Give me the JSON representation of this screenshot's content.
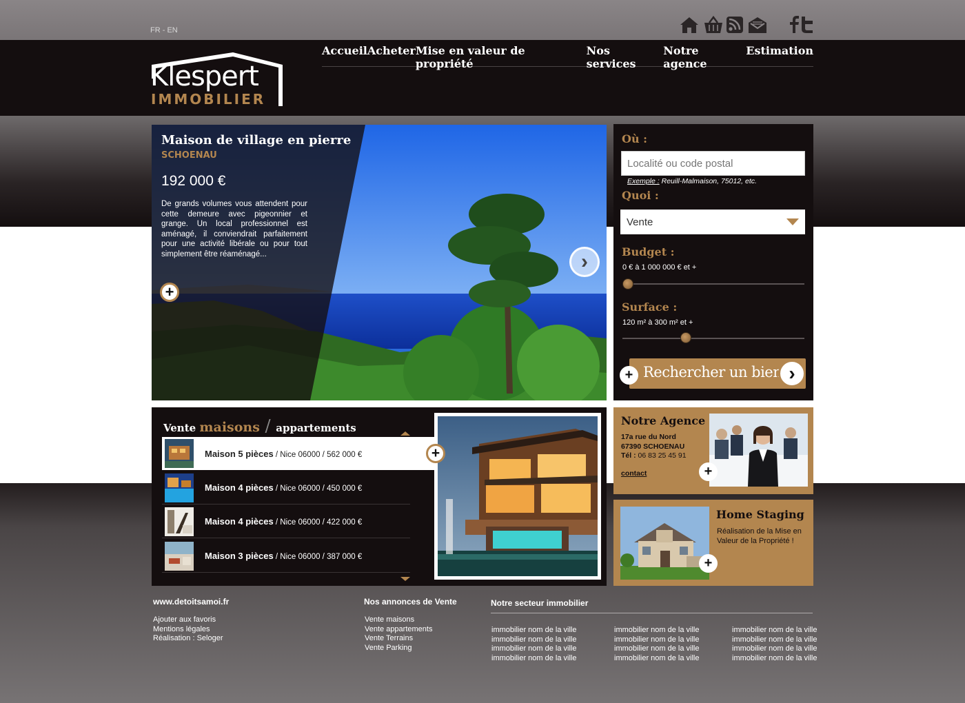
{
  "lang_switch": "FR - EN",
  "icons": [
    "home-icon",
    "basket-icon",
    "rss-icon",
    "mail-icon",
    "facebook-icon",
    "twitter-icon"
  ],
  "colors": {
    "accent": "#b3864f",
    "dark": "#140e0f",
    "sea": "#1b5fd8"
  },
  "logo": {
    "word": "Klespert",
    "sub": "IMMOBILIER"
  },
  "nav": [
    "Accueil",
    "Acheter",
    "Mise en valeur de propriété",
    "Nos services",
    "Notre agence",
    "Estimation"
  ],
  "hero": {
    "title": "Maison de village en pierre",
    "town": "SCHOENAU",
    "price": "192 000 €",
    "description": "De grands volumes vous attendent pour cette demeure avec pigeonnier et grange. Un local professionnel est aménagé, il conviendrait parfaitement pour une activité libérale ou pour tout simplement être réaménagé..."
  },
  "search": {
    "where_label": "Où :",
    "location_placeholder": "Localité ou code postal",
    "example_key": "Exemple :",
    "example_value": " Reuill-Malmaison, 75012, etc.",
    "what_label": "Quoi :",
    "type_value": "Vente",
    "budget_label": "Budget :",
    "budget_value": "0 € à 1 000 000 € et +",
    "surface_label": "Surface :",
    "surface_value": "120 m² à 300 m² et +",
    "submit_label": "Rechercher un bien"
  },
  "listings": {
    "title_pre": "Vente ",
    "title_accent": "maisons",
    "title_slash": " / ",
    "title_post": "appartements",
    "items": [
      {
        "name": "Maison 5 pièces",
        "detail": " / Nice 06000 / 562 000 €"
      },
      {
        "name": "Maison 4 pièces",
        "detail": " / Nice 06000 / 450 000 €"
      },
      {
        "name": "Maison 4 pièces",
        "detail": " / Nice 06000 / 422 000 €"
      },
      {
        "name": "Maison 3 pièces",
        "detail": " / Nice 06000 / 387 000 €"
      }
    ]
  },
  "agency": {
    "title": "Notre Agence",
    "street": "17a rue du Nord",
    "city": "67390 SCHOENAU",
    "tel_label": "Tél :",
    "tel": " 06 83 25 45 91",
    "contact": "contact"
  },
  "staging": {
    "title": "Home Staging",
    "description": "Réalisation de la Mise en Valeur de la Propriété !"
  },
  "footer": {
    "site": "www.detoitsamoi.fr",
    "links": [
      "Ajouter aux favoris",
      "Mentions légales",
      "Réalisation : Seloger"
    ],
    "announcements_title": "Nos annonces de Vente",
    "announcements": [
      "Vente maisons",
      "Vente appartements",
      "Vente Terrains",
      "Vente Parking"
    ],
    "sector_title": "Notre secteur immobilier",
    "sector_col1": [
      "immobilier nom de la ville",
      "immobilier nom de la ville",
      "immobilier nom de la ville",
      "immobilier nom de la ville"
    ],
    "sector_col2": [
      "immobilier nom de la ville",
      "immobilier nom de la ville",
      "immobilier nom de la ville",
      "immobilier nom de la ville"
    ],
    "sector_col3": [
      "immobilier nom de la ville",
      "immobilier nom de la ville",
      "immobilier nom de la ville",
      "immobilier nom de la ville"
    ]
  }
}
